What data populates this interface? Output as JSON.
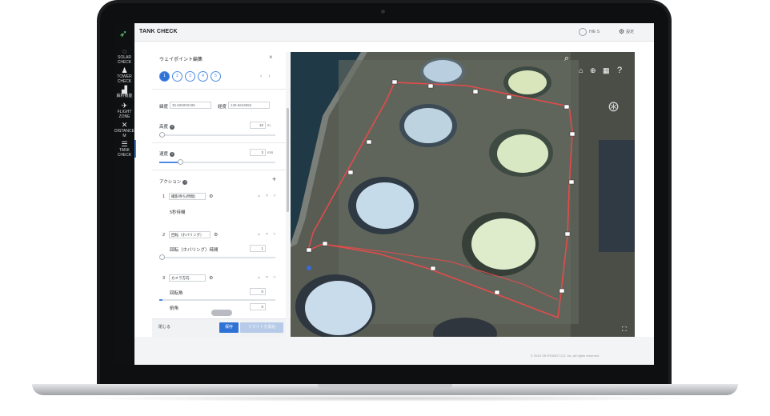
{
  "app": {
    "title": "TANK CHECK"
  },
  "header": {
    "user_name": "HIE S",
    "settings_label": "設定"
  },
  "nav": {
    "items": [
      {
        "label": "SOLAR CHECK",
        "icon": "solar-icon"
      },
      {
        "label": "TOWER CHECK",
        "icon": "tower-icon"
      },
      {
        "label": "解析機能",
        "icon": "factory-icon"
      },
      {
        "label": "FLIGHT ZONE",
        "icon": "plane-icon"
      },
      {
        "label": "DISTANCE M",
        "icon": "drone-icon"
      },
      {
        "label": "TANK CHECK",
        "icon": "tank-icon"
      }
    ]
  },
  "panel": {
    "title": "ウェイポイント編集",
    "steps": [
      "1",
      "2",
      "3",
      "4",
      "5"
    ],
    "lat_label": "緯度",
    "lat_value": "35.506002185",
    "lng_label": "経度",
    "lng_value": "139.6643652",
    "altitude_label": "高度",
    "altitude_value": "10",
    "altitude_unit": "m",
    "altitude_level": 0.02,
    "speed_label": "速度",
    "speed_value": "3",
    "speed_unit": "m/s",
    "speed_level": 0.18,
    "actions_label": "アクション",
    "actions": [
      {
        "index": "1",
        "select": "撮影待ち(時間)",
        "sub": "5秒待機"
      },
      {
        "index": "2",
        "select": "回転（ホバリング）",
        "sub": "回転（ホバリング）時間",
        "value": "1"
      },
      {
        "index": "3",
        "select": "カメラ方向",
        "sub_a": "回転角",
        "value_a": "0",
        "sub_b": "俯角",
        "value_b": "0"
      }
    ],
    "btn_close": "閉じる",
    "btn_save": "保存",
    "btn_flight": "フライトを開始"
  },
  "footer": {
    "copyright": "© 2020 SKYROBOT CO. Inc. All rights reserved."
  },
  "colors": {
    "accent": "#2f72d6",
    "route": "#e34b4b",
    "nav_bg": "#0f1012"
  }
}
